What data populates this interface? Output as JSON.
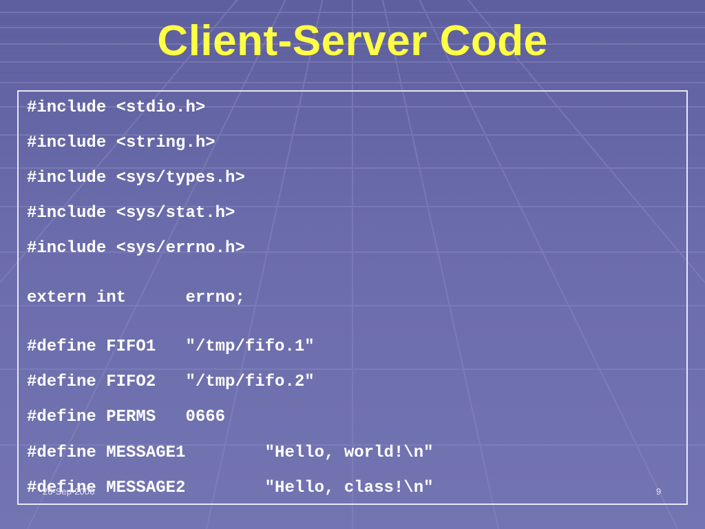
{
  "slide": {
    "title": "Client-Server Code",
    "code_lines": [
      "#include <stdio.h>",
      "#include <string.h>",
      "#include <sys/types.h>",
      "#include <sys/stat.h>",
      "#include <sys/errno.h>",
      "extern int      errno;",
      "#define FIFO1   \"/tmp/fifo.1\"",
      "#define FIFO2   \"/tmp/fifo.2\"",
      "#define PERMS   0666",
      "#define MESSAGE1        \"Hello, world!\\n\"",
      "#define MESSAGE2        \"Hello, class!\\n\""
    ],
    "footer_date": "26-Sep-2006",
    "page_number": "9"
  },
  "colors": {
    "background": "#6a6ba8",
    "title": "#ffff44",
    "code_text": "#ffffff",
    "code_border": "#e8e8f4"
  }
}
